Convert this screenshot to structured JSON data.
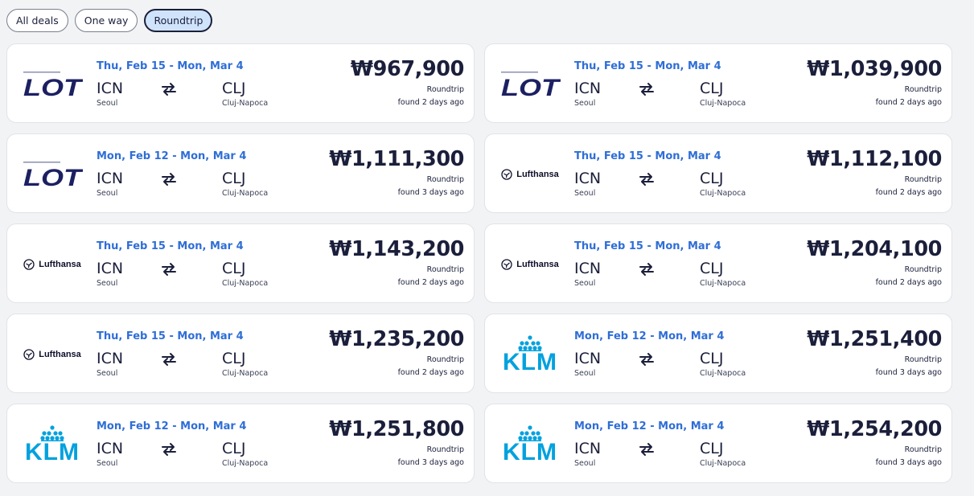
{
  "filters": [
    {
      "label": "All deals",
      "active": false
    },
    {
      "label": "One way",
      "active": false
    },
    {
      "label": "Roundtrip",
      "active": true
    }
  ],
  "deals": [
    {
      "airline": "lot",
      "airline_logo_text": "LOT",
      "dates": "Thu, Feb 15 - Mon, Mar 4",
      "origin_code": "ICN",
      "origin_city": "Seoul",
      "dest_code": "CLJ",
      "dest_city": "Cluj-Napoca",
      "price": "₩967,900",
      "trip_type": "Roundtrip",
      "found": "found 2 days ago"
    },
    {
      "airline": "lot",
      "airline_logo_text": "LOT",
      "dates": "Thu, Feb 15 - Mon, Mar 4",
      "origin_code": "ICN",
      "origin_city": "Seoul",
      "dest_code": "CLJ",
      "dest_city": "Cluj-Napoca",
      "price": "₩1,039,900",
      "trip_type": "Roundtrip",
      "found": "found 2 days ago"
    },
    {
      "airline": "lot",
      "airline_logo_text": "LOT",
      "dates": "Mon, Feb 12 - Mon, Mar 4",
      "origin_code": "ICN",
      "origin_city": "Seoul",
      "dest_code": "CLJ",
      "dest_city": "Cluj-Napoca",
      "price": "₩1,111,300",
      "trip_type": "Roundtrip",
      "found": "found 3 days ago"
    },
    {
      "airline": "lufthansa",
      "airline_logo_text": "Lufthansa",
      "dates": "Thu, Feb 15 - Mon, Mar 4",
      "origin_code": "ICN",
      "origin_city": "Seoul",
      "dest_code": "CLJ",
      "dest_city": "Cluj-Napoca",
      "price": "₩1,112,100",
      "trip_type": "Roundtrip",
      "found": "found 2 days ago"
    },
    {
      "airline": "lufthansa",
      "airline_logo_text": "Lufthansa",
      "dates": "Thu, Feb 15 - Mon, Mar 4",
      "origin_code": "ICN",
      "origin_city": "Seoul",
      "dest_code": "CLJ",
      "dest_city": "Cluj-Napoca",
      "price": "₩1,143,200",
      "trip_type": "Roundtrip",
      "found": "found 2 days ago"
    },
    {
      "airline": "lufthansa",
      "airline_logo_text": "Lufthansa",
      "dates": "Thu, Feb 15 - Mon, Mar 4",
      "origin_code": "ICN",
      "origin_city": "Seoul",
      "dest_code": "CLJ",
      "dest_city": "Cluj-Napoca",
      "price": "₩1,204,100",
      "trip_type": "Roundtrip",
      "found": "found 2 days ago"
    },
    {
      "airline": "lufthansa",
      "airline_logo_text": "Lufthansa",
      "dates": "Thu, Feb 15 - Mon, Mar 4",
      "origin_code": "ICN",
      "origin_city": "Seoul",
      "dest_code": "CLJ",
      "dest_city": "Cluj-Napoca",
      "price": "₩1,235,200",
      "trip_type": "Roundtrip",
      "found": "found 2 days ago"
    },
    {
      "airline": "klm",
      "airline_logo_text": "KLM",
      "dates": "Mon, Feb 12 - Mon, Mar 4",
      "origin_code": "ICN",
      "origin_city": "Seoul",
      "dest_code": "CLJ",
      "dest_city": "Cluj-Napoca",
      "price": "₩1,251,400",
      "trip_type": "Roundtrip",
      "found": "found 3 days ago"
    },
    {
      "airline": "klm",
      "airline_logo_text": "KLM",
      "dates": "Mon, Feb 12 - Mon, Mar 4",
      "origin_code": "ICN",
      "origin_city": "Seoul",
      "dest_code": "CLJ",
      "dest_city": "Cluj-Napoca",
      "price": "₩1,251,800",
      "trip_type": "Roundtrip",
      "found": "found 3 days ago"
    },
    {
      "airline": "klm",
      "airline_logo_text": "KLM",
      "dates": "Mon, Feb 12 - Mon, Mar 4",
      "origin_code": "ICN",
      "origin_city": "Seoul",
      "dest_code": "CLJ",
      "dest_city": "Cluj-Napoca",
      "price": "₩1,254,200",
      "trip_type": "Roundtrip",
      "found": "found 3 days ago"
    }
  ],
  "colors": {
    "accent_date": "#2f6ed6",
    "active_chip_bg": "#cfe3fb",
    "ink": "#1b1f3b",
    "lot_navy": "#1c2062",
    "klm_blue": "#00a1de"
  },
  "icons": {
    "swap": "swap-arrows-icon",
    "lufthansa_crane": "crane-icon",
    "klm_crown": "crown-icon"
  }
}
